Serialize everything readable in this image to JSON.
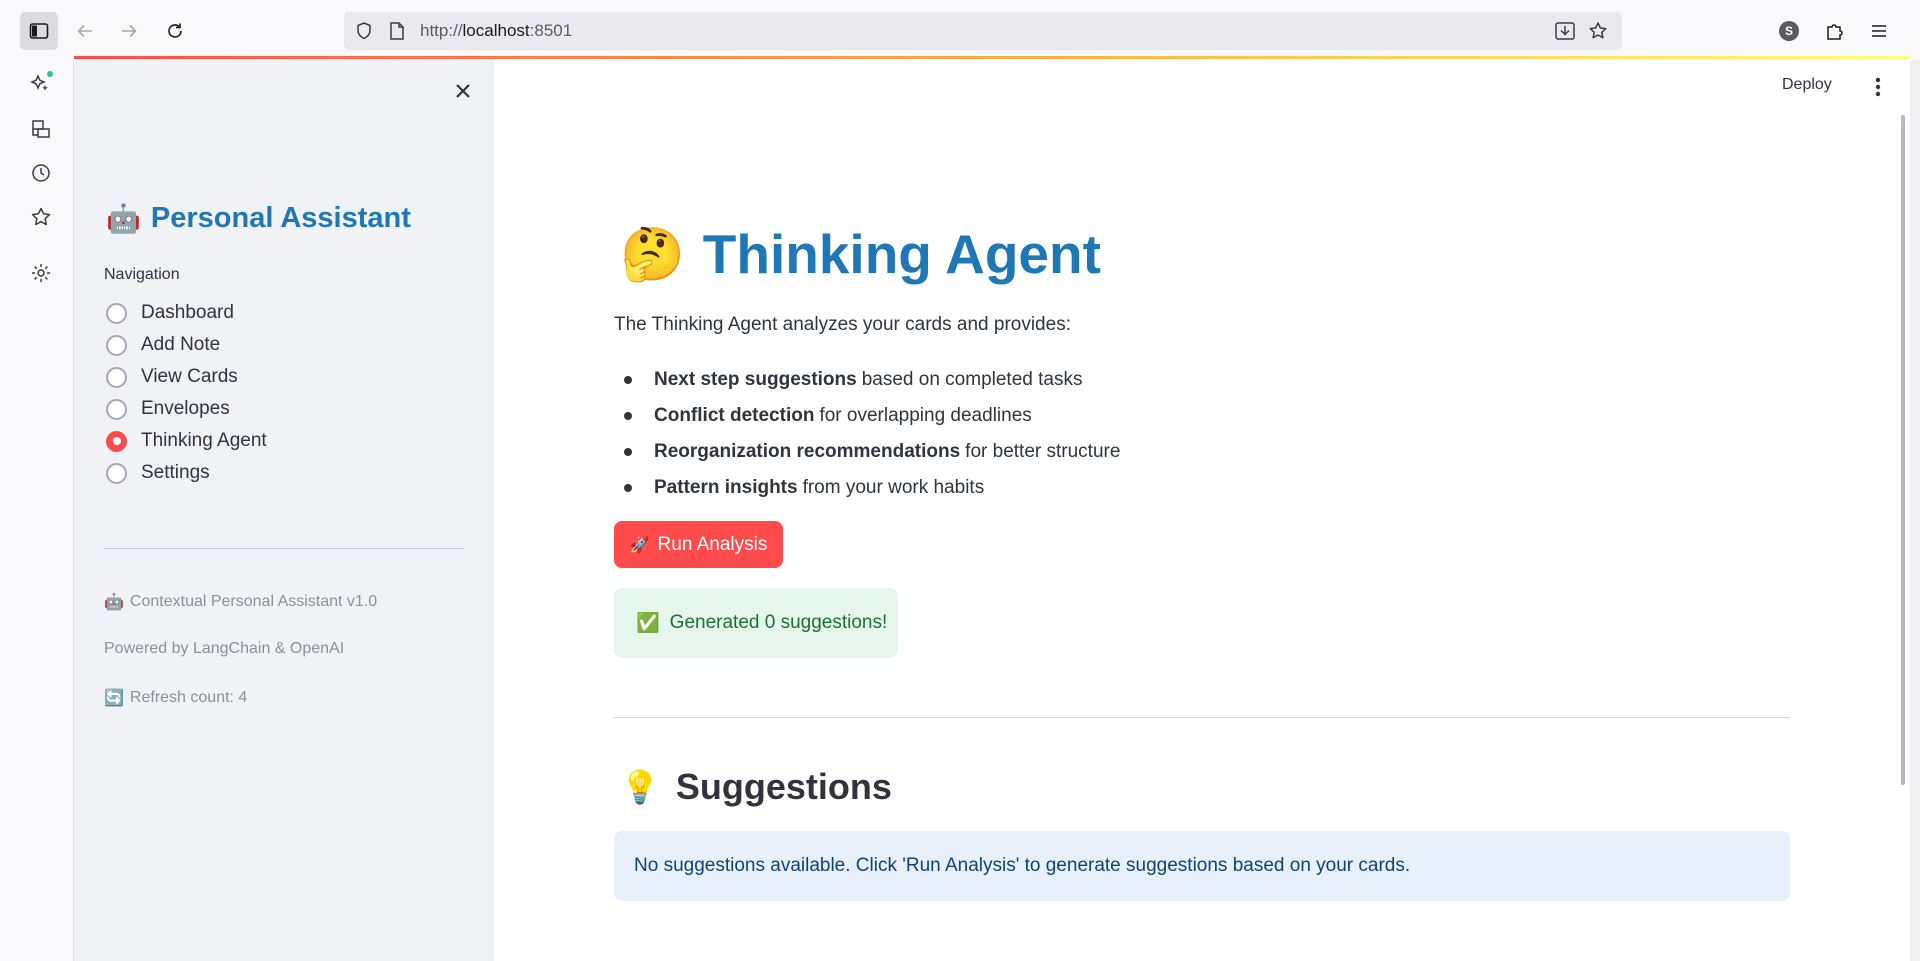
{
  "browser": {
    "url_scheme": "http://",
    "url_host": "localhost",
    "url_port": ":8501",
    "profile_initial": "S"
  },
  "app": {
    "deploy_label": "Deploy"
  },
  "sidebar": {
    "title_emoji": "🤖",
    "title": "Personal Assistant",
    "nav_label": "Navigation",
    "nav_items": [
      {
        "label": "Dashboard",
        "selected": false
      },
      {
        "label": "Add Note",
        "selected": false
      },
      {
        "label": "View Cards",
        "selected": false
      },
      {
        "label": "Envelopes",
        "selected": false
      },
      {
        "label": "Thinking Agent",
        "selected": true
      },
      {
        "label": "Settings",
        "selected": false
      }
    ],
    "footer": {
      "version_emoji": "🤖",
      "version": "Contextual Personal Assistant v1.0",
      "powered": "Powered by LangChain & OpenAI",
      "refresh_emoji": "🔄",
      "refresh": "Refresh count: 4"
    }
  },
  "main": {
    "title_emoji": "🤔",
    "title": "Thinking Agent",
    "intro": "The Thinking Agent analyzes your cards and provides:",
    "bullets": [
      {
        "bold": "Next step suggestions",
        "rest": "based on completed tasks"
      },
      {
        "bold": "Conflict detection",
        "rest": "for overlapping deadlines"
      },
      {
        "bold": "Reorganization recommendations",
        "rest": "for better structure"
      },
      {
        "bold": "Pattern insights",
        "rest": "from your work habits"
      }
    ],
    "run_button_emoji": "🚀",
    "run_button": "Run Analysis",
    "success_emoji": "✅",
    "success": "Generated 0 suggestions!",
    "suggestions_emoji": "💡",
    "suggestions_title": "Suggestions",
    "info": "No suggestions available. Click 'Run Analysis' to generate suggestions based on your cards."
  },
  "colors": {
    "accent": "#ff4b4b",
    "title_blue": "#1f77b4"
  }
}
